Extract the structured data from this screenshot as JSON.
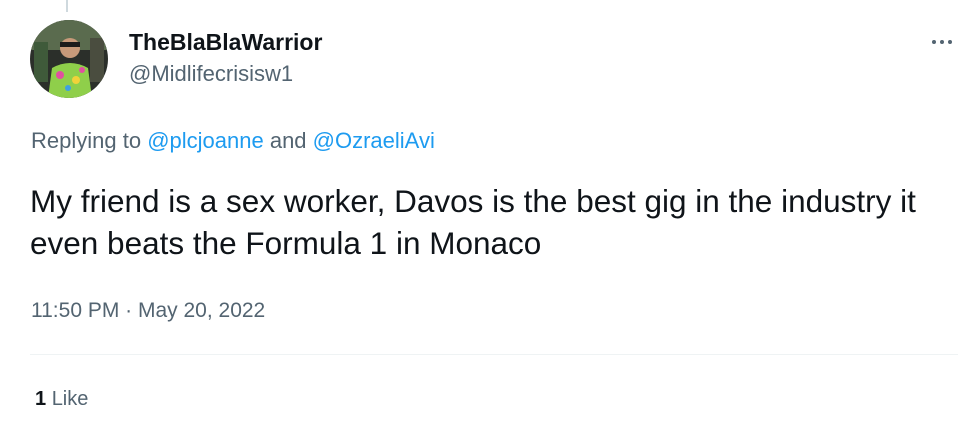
{
  "author": {
    "display_name": "TheBlaBlaWarrior",
    "handle": "@Midlifecrisisw1",
    "avatar_icon": "profile-photo"
  },
  "more_icon": "more-horizontal-icon",
  "reply": {
    "prefix": "Replying to ",
    "mention_1": "@plcjoanne",
    "conjunction": " and ",
    "mention_2": "@OzraeliAvi"
  },
  "tweet": {
    "text": "My friend is a sex worker, Davos is the best gig in the industry it even beats the Formula 1 in Monaco",
    "timestamp": "11:50 PM · May 20, 2022"
  },
  "stats": {
    "like_count": "1",
    "like_label": "Like"
  },
  "colors": {
    "text_primary": "#0f1419",
    "text_secondary": "#536471",
    "link": "#1d9bf0",
    "divider": "#eff3f4"
  }
}
